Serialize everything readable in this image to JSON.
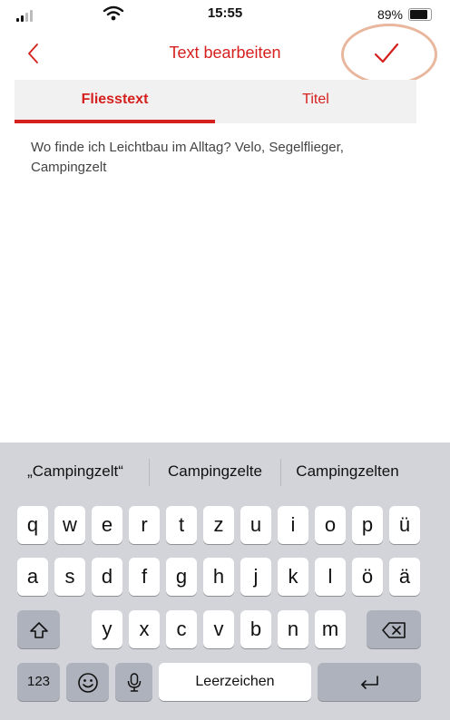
{
  "status_bar": {
    "time": "15:55",
    "battery": "89%"
  },
  "nav": {
    "title": "Text bearbeiten",
    "back_icon": "chevron-left-icon",
    "done_icon": "checkmark-icon",
    "accent_color": "#d5201e"
  },
  "tabs": [
    {
      "label": "Fliesstext",
      "selected": true
    },
    {
      "label": "Titel",
      "selected": false
    }
  ],
  "editor": {
    "text": "Wo finde ich Leichtbau im Alltag? Velo, Segelflieger, Campingzelt"
  },
  "keyboard": {
    "suggestions": [
      "„Campingzelt“",
      "Campingzelte",
      "Campingzelten"
    ],
    "row1": [
      "q",
      "w",
      "e",
      "r",
      "t",
      "z",
      "u",
      "i",
      "o",
      "p",
      "ü"
    ],
    "row2": [
      "a",
      "s",
      "d",
      "f",
      "g",
      "h",
      "j",
      "k",
      "l",
      "ö",
      "ä"
    ],
    "row3": [
      "y",
      "x",
      "c",
      "v",
      "b",
      "n",
      "m"
    ],
    "numbers_label": "123",
    "space_label": "Leerzeichen",
    "shift_icon": "shift-icon",
    "delete_icon": "backspace-icon",
    "emoji_icon": "emoji-icon",
    "mic_icon": "microphone-icon",
    "return_icon": "return-icon"
  }
}
